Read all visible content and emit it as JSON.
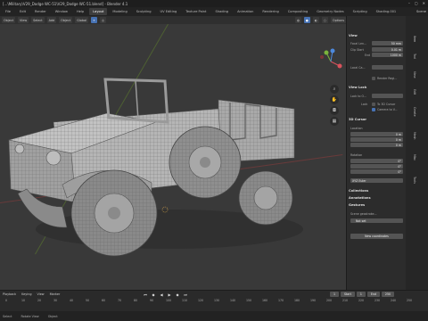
{
  "window": {
    "title": "[...\\Military\\V29_Dodge WC-51\\V29_Dodge WC-51.blend] - Blender 4.1",
    "controls": [
      "–",
      "▢",
      "✕"
    ]
  },
  "workspaces": {
    "items": [
      "File",
      "Edit",
      "Render",
      "Window",
      "Help",
      "Layout",
      "Modeling",
      "Sculpting",
      "UV Editing",
      "Texture Paint",
      "Shading",
      "Animation",
      "Rendering",
      "Compositing",
      "Geometry Nodes",
      "Scripting",
      "Shading.001"
    ],
    "active_index": 5,
    "scene_label": "Scene"
  },
  "header3d": {
    "mode": "Object",
    "view": "View",
    "select": "Select",
    "add": "Add",
    "object": "Object",
    "orientation": "Global",
    "options": "Options"
  },
  "npanel": {
    "view_section": "View",
    "focal_label": "Focal Len...",
    "focal_value": "50 mm",
    "clip_start_label": "Clip Start",
    "clip_start_value": "0.01 m",
    "clip_end_label": "End",
    "clip_end_value": "1000 m",
    "local_camera_label": "Local Ca...",
    "render_region_label": "Render Regi...",
    "view_lock_section": "View Lock",
    "lock_to_object_label": "Lock to O...",
    "lock_label": "Lock",
    "lock_3d_cursor": "To 3D Cursor",
    "camera_to_view": "Camera to V...",
    "cursor_section": "3D Cursor",
    "location_label": "Location",
    "loc_x_label": "X",
    "loc_x": "0 m",
    "loc_y_label": "Y",
    "loc_y": "0 m",
    "loc_z_label": "Z",
    "loc_z": "0 m",
    "rotation_label": "Rotation",
    "rot_x_label": "X",
    "rot_x": "0°",
    "rot_y_label": "Y",
    "rot_y": "0°",
    "rot_z_label": "Z",
    "rot_z": "0°",
    "rotation_mode": "XYZ Euler",
    "collections_section": "Collections",
    "annotations_section": "Annotations",
    "gestures_section": "Gestures",
    "gesture_label": "Scene geostroke...",
    "gesture_value": "Not set",
    "gesture_btn": "New coordinates"
  },
  "sidetabs": [
    "Item",
    "Tool",
    "View",
    "Edit",
    "Create",
    "Mesh",
    "Misc",
    "Tools"
  ],
  "timeline": {
    "playback": "Playback",
    "keying": "Keying",
    "view": "View",
    "marker": "Marker",
    "current_frame": "1",
    "start_label": "Start",
    "start": "1",
    "end_label": "End",
    "end": "250",
    "ticks": [
      "0",
      "10",
      "20",
      "30",
      "40",
      "50",
      "60",
      "70",
      "80",
      "90",
      "100",
      "110",
      "120",
      "130",
      "140",
      "150",
      "160",
      "170",
      "180",
      "190",
      "200",
      "210",
      "220",
      "230",
      "240",
      "250"
    ]
  },
  "status": {
    "select": "Select",
    "rotate": "Rotate View",
    "object": "Object"
  }
}
